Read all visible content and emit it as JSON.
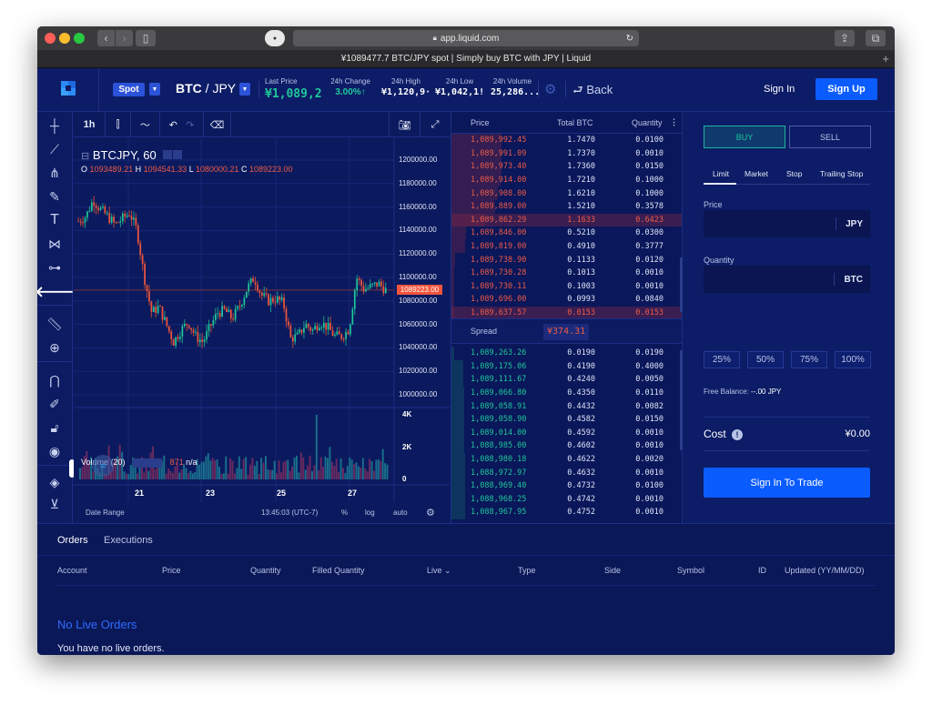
{
  "browser": {
    "url": "app.liquid.com",
    "tab_title": "¥1089477.7 BTC/JPY spot | Simply buy BTC with JPY | Liquid"
  },
  "header": {
    "market_type": "Spot",
    "pair_base": "BTC",
    "pair_sep": " / ",
    "pair_quote": "JPY",
    "stats": [
      {
        "label": "Last Price",
        "value": "¥1,089,2:"
      },
      {
        "label": "24h Change",
        "value": "3.00%↑"
      },
      {
        "label": "24h High",
        "value": "¥1,120,9·"
      },
      {
        "label": "24h Low",
        "value": "¥1,042,1!"
      },
      {
        "label": "24h Volume",
        "value": "25,286..."
      }
    ],
    "back_label": "Back",
    "sign_in": "Sign In",
    "sign_up": "Sign Up",
    "colors": {
      "accent": "#0b5cff",
      "up": "#1fc79a",
      "down": "#ee5a45"
    }
  },
  "chart_toolbar": {
    "interval": "1h"
  },
  "chart": {
    "symbol_title": "BTCJPY, 60",
    "ohlc": {
      "o_label": "O",
      "o": "1093489.21",
      "h_label": "H",
      "h": "1094541.33",
      "l_label": "L",
      "l": "1080000.21",
      "c_label": "C",
      "c": "1089223.00"
    },
    "price_ticks": [
      "1200000.00",
      "1180000.00",
      "1160000.00",
      "1140000.00",
      "1120000.00",
      "1100000.00",
      "1080000.00",
      "1060000.00",
      "1040000.00",
      "1020000.00",
      "1000000.00"
    ],
    "current_price": "1089223.00",
    "volume_title": "Volume (20)",
    "volume_value": "871",
    "volume_na": "n/a",
    "volume_ticks": [
      "4K",
      "2K",
      "0"
    ],
    "date_ticks": [
      "21",
      "23",
      "25",
      "27"
    ],
    "footer": {
      "date_range": "Date Range",
      "time": "13:45:03 (UTC-7)",
      "percent": "%",
      "log": "log",
      "auto": "auto"
    }
  },
  "chart_data": {
    "type": "candlestick",
    "title": "BTCJPY, 60",
    "xlabel": "",
    "ylabel": "",
    "x_ticks": [
      "21",
      "23",
      "25",
      "27"
    ],
    "ylim": [
      1000000,
      1200000
    ],
    "y_ticks": [
      1000000,
      1020000,
      1040000,
      1060000,
      1080000,
      1100000,
      1120000,
      1140000,
      1160000,
      1180000,
      1200000
    ],
    "approx_close_path": [
      1148000,
      1152000,
      1166000,
      1158000,
      1152000,
      1145000,
      1150000,
      1155000,
      1140000,
      1100000,
      1070000,
      1075000,
      1060000,
      1045000,
      1055000,
      1062000,
      1050000,
      1045000,
      1058000,
      1070000,
      1072000,
      1065000,
      1075000,
      1090000,
      1100000,
      1085000,
      1080000,
      1082000,
      1078000,
      1048000,
      1050000,
      1060000,
      1055000,
      1062000,
      1058000,
      1050000,
      1050000,
      1056000,
      1100000,
      1090000,
      1092000,
      1095000,
      1089223
    ],
    "volume_ylim": [
      0,
      4000
    ],
    "volume_ticks": [
      0,
      2000,
      4000
    ],
    "last_ohlc": {
      "open": 1093489.21,
      "high": 1094541.33,
      "low": 1080000.21,
      "close": 1089223.0
    }
  },
  "orderbook": {
    "headers": {
      "price": "Price",
      "total": "Total BTC",
      "quantity": "Quantity"
    },
    "asks": [
      {
        "price": "1,089,992.45",
        "total": "1.7470",
        "qty": "0.0100"
      },
      {
        "price": "1,089,991.09",
        "total": "1.7370",
        "qty": "0.0010"
      },
      {
        "price": "1,089,973.40",
        "total": "1.7360",
        "qty": "0.0150"
      },
      {
        "price": "1,089,914.00",
        "total": "1.7210",
        "qty": "0.1000"
      },
      {
        "price": "1,089,908.00",
        "total": "1.6210",
        "qty": "0.1000"
      },
      {
        "price": "1,089,889.00",
        "total": "1.5210",
        "qty": "0.3578"
      },
      {
        "price": "1,089,862.29",
        "total": "1.1633",
        "qty": "0.6423",
        "highlight": true
      },
      {
        "price": "1,089,846.00",
        "total": "0.5210",
        "qty": "0.0300"
      },
      {
        "price": "1,089,819.00",
        "total": "0.4910",
        "qty": "0.3777"
      },
      {
        "price": "1,089,738.90",
        "total": "0.1133",
        "qty": "0.0120"
      },
      {
        "price": "1,089,730.28",
        "total": "0.1013",
        "qty": "0.0010"
      },
      {
        "price": "1,089,730.11",
        "total": "0.1003",
        "qty": "0.0010"
      },
      {
        "price": "1,089,696.00",
        "total": "0.0993",
        "qty": "0.0840"
      },
      {
        "price": "1,089,637.57",
        "total": "0.0153",
        "qty": "0.0153",
        "highlight": true
      }
    ],
    "spread_label": "Spread",
    "spread_value": "¥374.31",
    "bids": [
      {
        "price": "1,089,263.26",
        "total": "0.0190",
        "qty": "0.0190"
      },
      {
        "price": "1,089,175.06",
        "total": "0.4190",
        "qty": "0.4000"
      },
      {
        "price": "1,089,111.67",
        "total": "0.4240",
        "qty": "0.0050"
      },
      {
        "price": "1,089,066.80",
        "total": "0.4350",
        "qty": "0.0110"
      },
      {
        "price": "1,089,058.91",
        "total": "0.4432",
        "qty": "0.0082"
      },
      {
        "price": "1,089,058.90",
        "total": "0.4582",
        "qty": "0.0150"
      },
      {
        "price": "1,089,014.00",
        "total": "0.4592",
        "qty": "0.0010"
      },
      {
        "price": "1,088,985.00",
        "total": "0.4602",
        "qty": "0.0010"
      },
      {
        "price": "1,088,980.18",
        "total": "0.4622",
        "qty": "0.0020"
      },
      {
        "price": "1,088,972.97",
        "total": "0.4632",
        "qty": "0.0010"
      },
      {
        "price": "1,088,969.40",
        "total": "0.4732",
        "qty": "0.0100"
      },
      {
        "price": "1,088,968.25",
        "total": "0.4742",
        "qty": "0.0010"
      },
      {
        "price": "1,088,967.95",
        "total": "0.4752",
        "qty": "0.0010"
      }
    ]
  },
  "trade": {
    "buy": "BUY",
    "sell": "SELL",
    "order_types": [
      "Limit",
      "Market",
      "Stop",
      "Trailing Stop"
    ],
    "active_order_type": "Limit",
    "price_label": "Price",
    "price_unit": "JPY",
    "price_value": "",
    "quantity_label": "Quantity",
    "quantity_unit": "BTC",
    "quantity_value": "",
    "percent_options": [
      "25%",
      "50%",
      "75%",
      "100%"
    ],
    "free_balance_label": "Free Balance:",
    "free_balance_value": "--.00 JPY",
    "cost_label": "Cost",
    "cost_value": "¥0.00",
    "submit": "Sign In To Trade"
  },
  "orders": {
    "tabs": [
      "Orders",
      "Executions"
    ],
    "active_tab": "Orders",
    "columns": [
      "Account",
      "Price",
      "Quantity",
      "Filled Quantity",
      "Live ⌄",
      "Type",
      "Side",
      "Symbol",
      "ID",
      "Updated (YY/MM/DD)"
    ],
    "empty_title": "No Live Orders",
    "empty_message": "You have no live orders."
  }
}
